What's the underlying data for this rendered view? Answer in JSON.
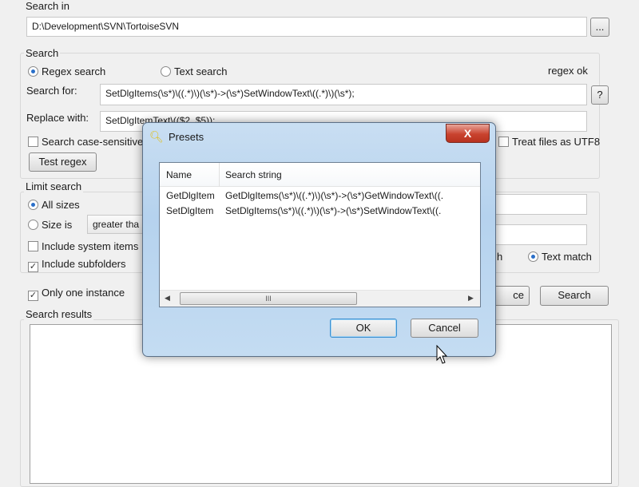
{
  "search_in": {
    "label": "Search in",
    "path": "D:\\Development\\SVN\\TortoiseSVN",
    "browse_label": "..."
  },
  "search": {
    "group_label": "Search",
    "regex_label": "Regex search",
    "text_label": "Text search",
    "status": "regex ok",
    "search_for_label": "Search for:",
    "search_for_value": "SetDlgItems(\\s*)\\((.*)\\)(\\s*)->(\\s*)SetWindowText\\((.*)\\)(\\s*);",
    "help_label": "?",
    "replace_label": "Replace with:",
    "replace_value": "SetDlgItemText\\(($2, $5));",
    "case_label": "Search case-sensitive",
    "utf8_label": "Treat files as UTF8",
    "test_label": "Test regex"
  },
  "limit": {
    "group_label": "Limit search",
    "all_sizes": "All sizes",
    "size_is": "Size is",
    "size_op": "greater tha",
    "system_items": "Include system items",
    "subfolders": "Include subfolders",
    "partial_label": "h",
    "text_match": "Text match"
  },
  "actions": {
    "one_instance": "Only one instance",
    "replace_partial": "ce",
    "search_label": "Search"
  },
  "results": {
    "group_label": "Search results"
  },
  "dialog": {
    "title": "Presets",
    "close_label": "X",
    "columns": [
      "Name",
      "Search string"
    ],
    "rows": [
      {
        "name": "GetDlgItem",
        "value": "GetDlgItems(\\s*)\\((.*)\\)(\\s*)->(\\s*)GetWindowText\\((."
      },
      {
        "name": "SetDlgItem",
        "value": "SetDlgItems(\\s*)\\((.*)\\)(\\s*)->(\\s*)SetWindowText\\((."
      }
    ],
    "scroll_grip": "III",
    "ok_label": "OK",
    "cancel_label": "Cancel"
  }
}
